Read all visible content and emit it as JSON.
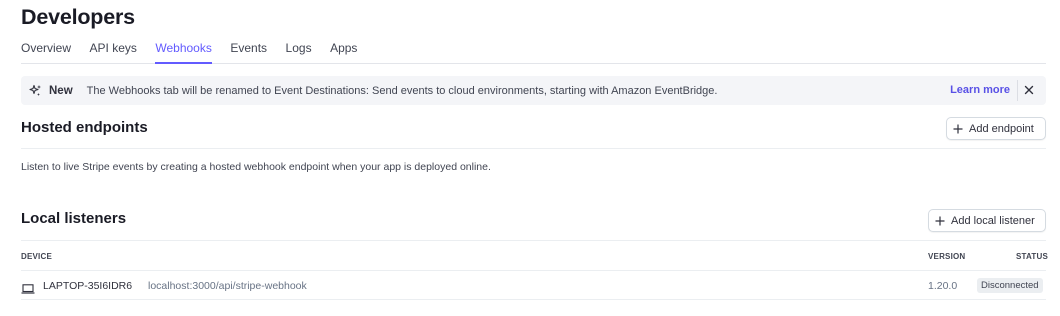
{
  "header": {
    "title": "Developers"
  },
  "tabs": [
    {
      "label": "Overview",
      "active": false
    },
    {
      "label": "API keys",
      "active": false
    },
    {
      "label": "Webhooks",
      "active": true
    },
    {
      "label": "Events",
      "active": false
    },
    {
      "label": "Logs",
      "active": false
    },
    {
      "label": "Apps",
      "active": false
    }
  ],
  "banner": {
    "icon": "sparkle-icon",
    "badge": "New",
    "text": "The Webhooks tab will be renamed to Event Destinations: Send events to cloud environments, starting with Amazon EventBridge.",
    "link": "Learn more",
    "close_icon": "close-icon"
  },
  "hosted": {
    "title": "Hosted endpoints",
    "add_button": "Add endpoint",
    "description": "Listen to live Stripe events by creating a hosted webhook endpoint when your app is deployed online."
  },
  "local": {
    "title": "Local listeners",
    "add_button": "Add local listener",
    "columns": {
      "device": "DEVICE",
      "version": "VERSION",
      "status": "STATUS"
    },
    "rows": [
      {
        "icon": "laptop-icon",
        "device": "LAPTOP-35I6IDR6",
        "url": "localhost:3000/api/stripe-webhook",
        "version": "1.20.0",
        "status": "Disconnected"
      }
    ]
  },
  "colors": {
    "accent": "#635bff",
    "text": "#30313d",
    "muted": "#687385",
    "banner_bg": "#f4f5f8"
  }
}
